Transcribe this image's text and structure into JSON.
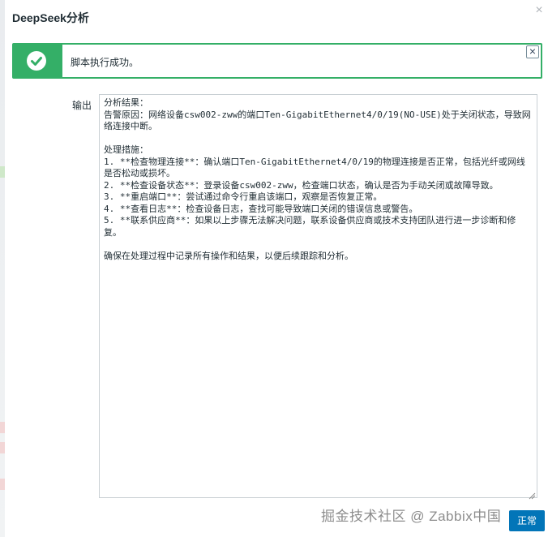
{
  "dialog": {
    "title": "DeepSeek分析",
    "close_symbol": "×"
  },
  "message": {
    "text": "脚本执行成功。",
    "icon": "check-circle-icon",
    "close_symbol": "×",
    "color": "#34af67"
  },
  "output": {
    "label": "输出",
    "value": "分析结果：\n告警原因：网络设备csw002-zww的端口Ten-GigabitEthernet4/0/19(NO-USE)处于关闭状态，导致网络连接中断。\n\n处理措施：\n1. **检查物理连接**：确认端口Ten-GigabitEthernet4/0/19的物理连接是否正常，包括光纤或网线是否松动或损坏。\n2. **检查设备状态**：登录设备csw002-zww，检查端口状态，确认是否为手动关闭或故障导致。\n3. **重启端口**：尝试通过命令行重启该端口，观察是否恢复正常。\n4. **查看日志**：检查设备日志，查找可能导致端口关闭的错误信息或警告。\n5. **联系供应商**：如果以上步骤无法解决问题，联系设备供应商或技术支持团队进行进一步诊断和修复。\n\n确保在处理过程中记录所有操作和结果，以便后续跟踪和分析。"
  },
  "footer": {
    "ok_label": "正常",
    "accent_color": "#0275b8"
  },
  "watermark": {
    "text": "掘金技术社区 @ Zabbix中国"
  }
}
